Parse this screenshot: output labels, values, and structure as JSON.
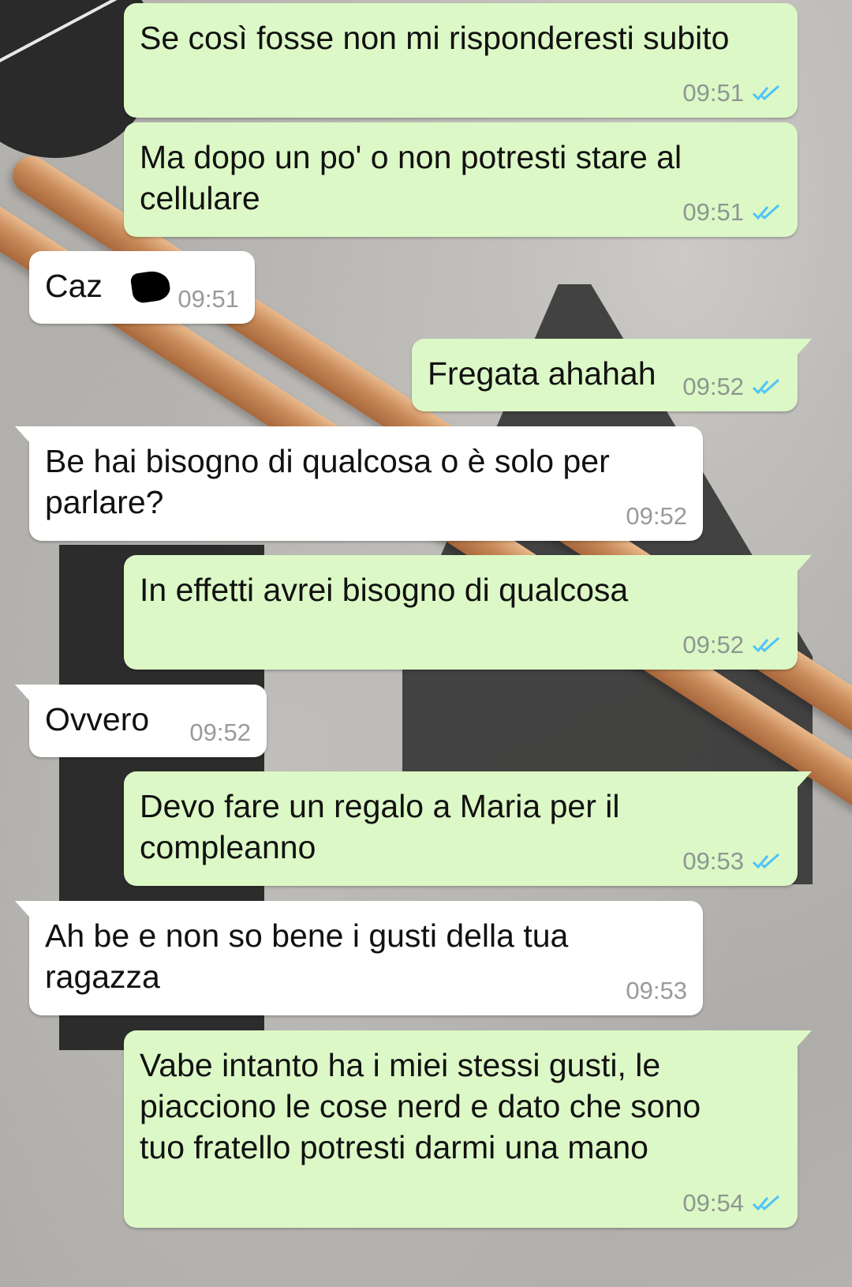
{
  "colors": {
    "outgoing_bubble": "#dcf8c6",
    "incoming_bubble": "#ffffff",
    "read_ticks": "#4fc3f7",
    "timestamp": "#8e9690"
  },
  "messages": [
    {
      "direction": "out",
      "text": "Se così fosse non mi risponderesti subito",
      "time": "09:51",
      "status": "read"
    },
    {
      "direction": "out",
      "text": "Ma dopo un po' o non potresti stare al\ncellulare",
      "time": "09:51",
      "status": "read"
    },
    {
      "direction": "in",
      "text": "Caz",
      "time": "09:51",
      "redacted": true
    },
    {
      "direction": "out",
      "text": "Fregata ahahah",
      "time": "09:52",
      "status": "read"
    },
    {
      "direction": "in",
      "text": "Be hai bisogno di qualcosa o è solo per\nparlare?",
      "time": "09:52"
    },
    {
      "direction": "out",
      "text": "In effetti avrei bisogno di qualcosa",
      "time": "09:52",
      "status": "read"
    },
    {
      "direction": "in",
      "text": "Ovvero",
      "time": "09:52"
    },
    {
      "direction": "out",
      "text": "Devo fare un regalo a Maria per il\ncompleanno",
      "time": "09:53",
      "status": "read"
    },
    {
      "direction": "in",
      "text": "Ah be e non so bene i gusti della tua\nragazza",
      "time": "09:53"
    },
    {
      "direction": "out",
      "text": "Vabe intanto ha i miei stessi gusti, le\npiacciono le cose nerd e dato che sono\ntuo fratello potresti darmi una mano",
      "time": "09:54",
      "status": "read"
    }
  ]
}
